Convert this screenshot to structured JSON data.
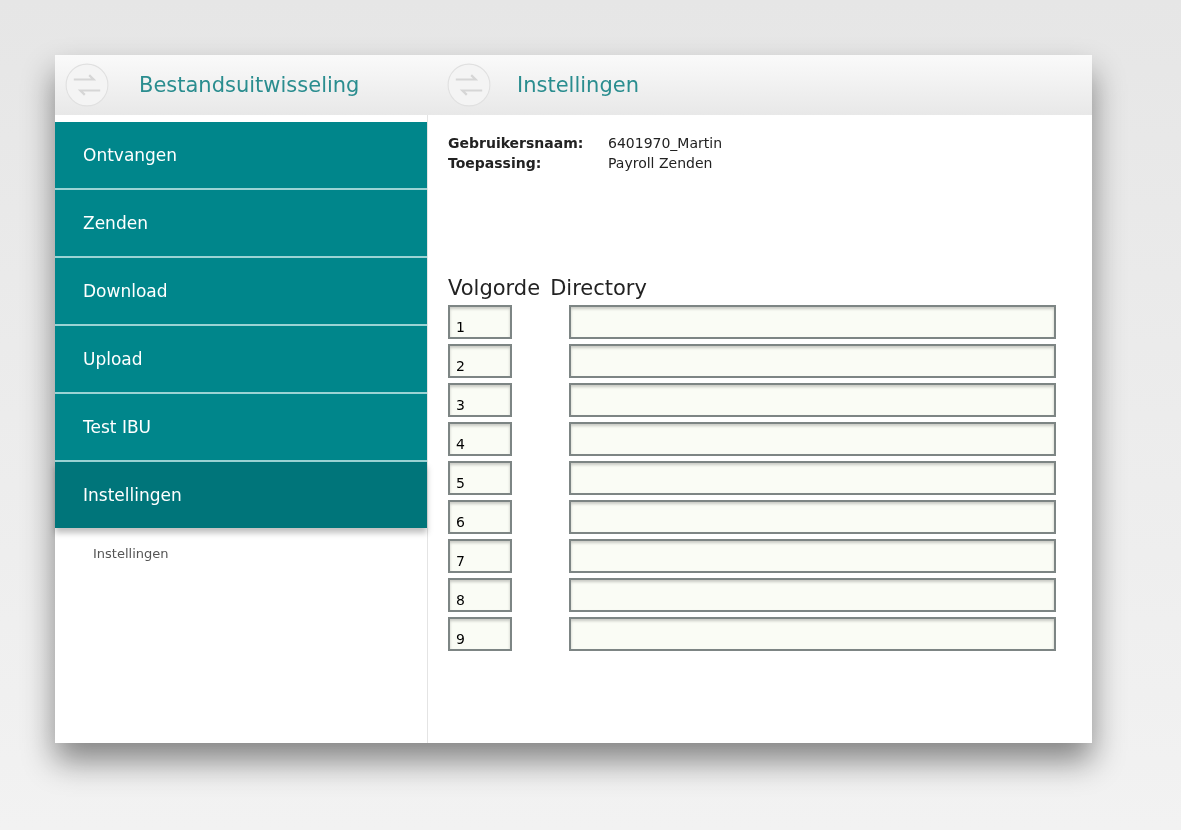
{
  "header": {
    "app_title": "Bestandsuitwisseling",
    "page_title": "Instellingen"
  },
  "sidebar": {
    "items": [
      {
        "label": "Ontvangen",
        "selected": false
      },
      {
        "label": "Zenden",
        "selected": false
      },
      {
        "label": "Download",
        "selected": false
      },
      {
        "label": "Upload",
        "selected": false
      },
      {
        "label": "Test IBU",
        "selected": false
      },
      {
        "label": "Instellingen",
        "selected": true
      }
    ],
    "sub_items": [
      "Instellingen"
    ]
  },
  "info": [
    {
      "label": "Gebruikersnaam:",
      "value": "6401970_Martin"
    },
    {
      "label": "Toepassing:",
      "value": "Payroll Zenden"
    }
  ],
  "table": {
    "columns": [
      "Volgorde",
      "Directory"
    ],
    "rows": [
      {
        "order": "1"
      },
      {
        "order": "2"
      },
      {
        "order": "3"
      },
      {
        "order": "4"
      },
      {
        "order": "5"
      },
      {
        "order": "6"
      },
      {
        "order": "7"
      },
      {
        "order": "8"
      },
      {
        "order": "9"
      }
    ]
  }
}
